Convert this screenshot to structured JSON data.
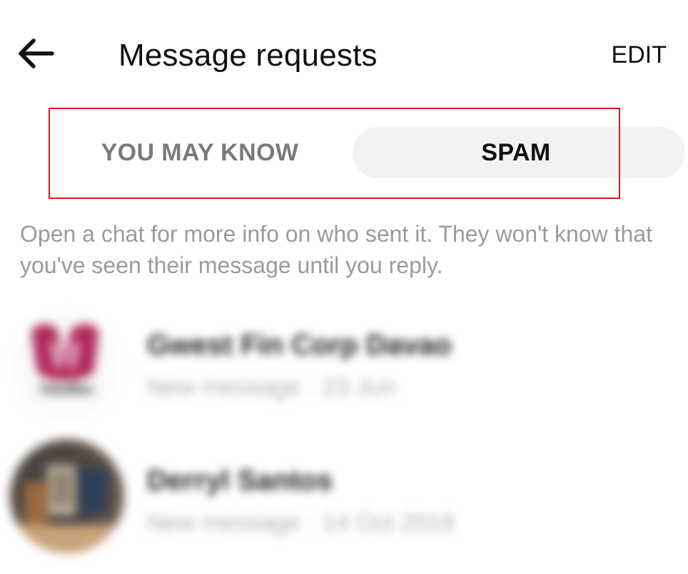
{
  "header": {
    "title": "Message requests",
    "edit_label": "EDIT"
  },
  "tabs": [
    {
      "label": "YOU MAY KNOW",
      "selected": false
    },
    {
      "label": "SPAM",
      "selected": true
    }
  ],
  "info_text": "Open a chat for more info on who sent it. They won't know that you've seen their message until you reply.",
  "requests": [
    {
      "name": "Gwest Fin Corp Davao",
      "subtitle": "New message · 23 Jun",
      "avatar_text": "ValuMax"
    },
    {
      "name": "Derryl Santos",
      "subtitle": "New message · 14 Oct 2018"
    }
  ],
  "colors": {
    "highlight_outline": "#d81b1b",
    "selected_tab_bg": "#f2f2f2",
    "muted_text": "#9b9b9b",
    "avatar_brand": "#b0295a"
  }
}
